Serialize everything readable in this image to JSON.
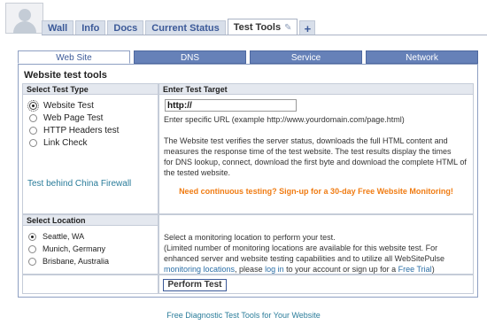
{
  "profile_tabs": {
    "items": [
      "Wall",
      "Info",
      "Docs",
      "Current Status",
      "Test Tools"
    ],
    "plus_label": "+"
  },
  "tool_tabs": [
    "Web Site",
    "DNS",
    "Service",
    "Network"
  ],
  "panel": {
    "title": "Website test tools",
    "select_test_type": {
      "heading": "Select Test Type",
      "options": [
        "Website Test",
        "Web Page Test",
        "HTTP Headers test",
        "Link Check"
      ],
      "selected": "Website Test",
      "china_link": "Test behind China Firewall"
    },
    "enter_target": {
      "heading": "Enter Test Target",
      "url_value": "http://",
      "hint": "Enter specific URL (example http://www.yourdomain.com/page.html)",
      "desc_line1": "The Website test verifies the server status, downloads the full HTML content and",
      "desc_line2": "measures the response time of the test website. The test results display the times",
      "desc_line3": "for DNS lookup, connect, download the first byte and download the complete HTML of",
      "desc_line4": "the tested website.",
      "promo": "Need continuous testing? Sign-up for a 30-day Free Website Monitoring!"
    },
    "select_location": {
      "heading": "Select Location",
      "options": [
        "Seattle, WA",
        "Munich, Germany",
        "Brisbane, Australia"
      ],
      "selected": "Seattle, WA"
    },
    "location_info": {
      "line1": "Select a monitoring location to perform your test.",
      "line2": "(Limited number of monitoring locations are available for this website test. For",
      "line3": "enhanced server and website testing capabilities and to utilize all WebSitePulse",
      "link_locations": "monitoring locations",
      "mid1": ", please ",
      "link_login": "log in",
      "mid2": " to your account or sign up for a ",
      "link_trial": "Free Trial",
      "end": ")"
    },
    "perform_button": "Perform Test"
  },
  "footer_link": "Free Diagnostic Test Tools for Your Website",
  "colors": {
    "tab_blue": "#6681b8",
    "accent_orange": "#f07c13",
    "link": "#2a7c9a"
  }
}
